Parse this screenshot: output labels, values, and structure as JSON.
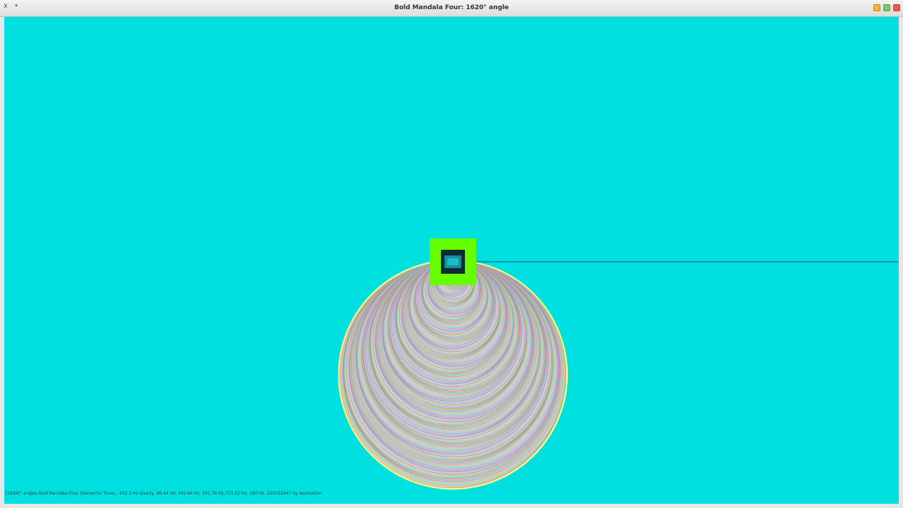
{
  "window": {
    "title": "Bold Mandala Four: 1620° angle",
    "left_controls": [
      "x",
      "•"
    ]
  },
  "canvas": {
    "background": "#00e0e0",
    "status_text": "[1620]° angles-Bold Mandala Four- Elemental Tones - 452.2 Hz steady, 90.44 Hz, 542.64 Hz, 361.76 Hz,723.52 Hz, 180 Hz -250152447 by leonhatton"
  },
  "colors": {
    "cursor_green": "#66ff00",
    "horizon_line": "#0a4a8a",
    "ring_outer": "#f4ff80"
  },
  "icons": {
    "close": "close-icon",
    "minimize": "minimize-icon",
    "maximize": "maximize-icon"
  }
}
